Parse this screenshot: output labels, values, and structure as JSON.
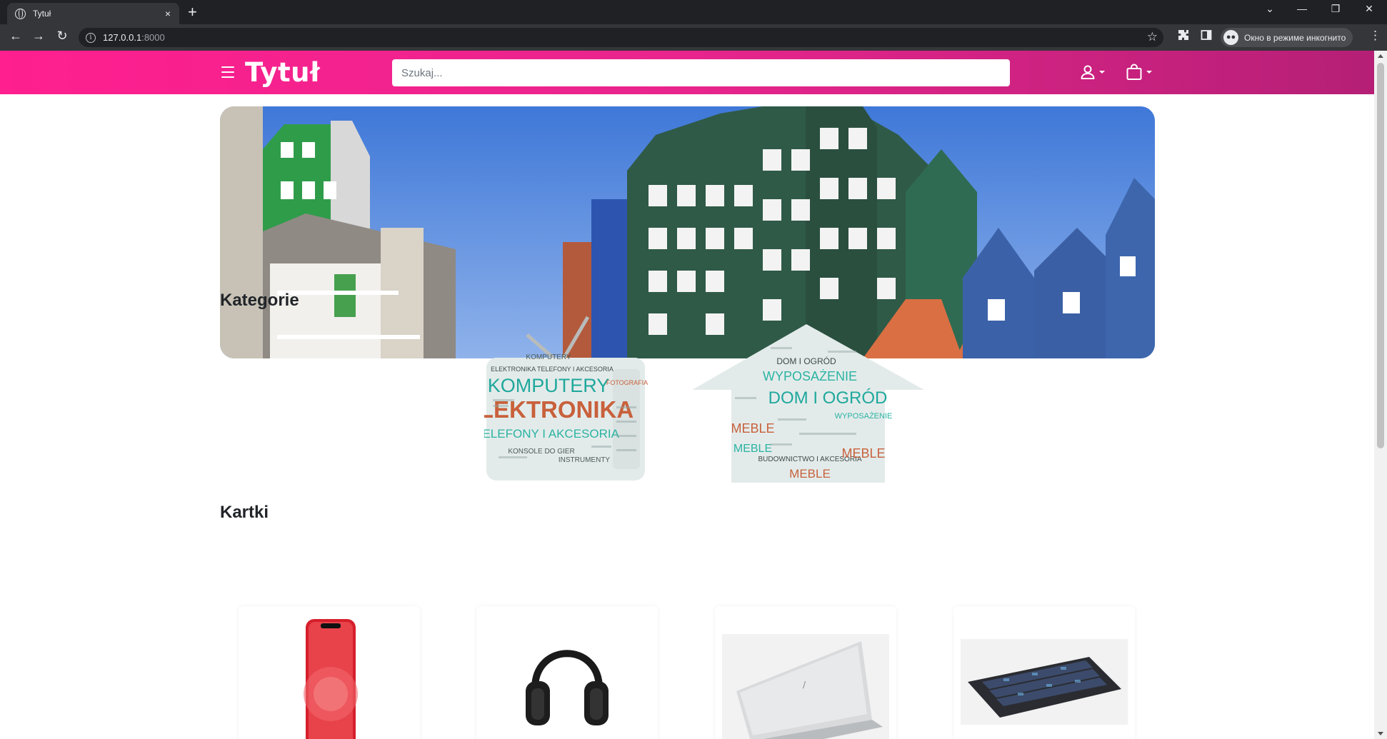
{
  "browser": {
    "tab_title": "Tytuł",
    "tab_close": "×",
    "new_tab": "+",
    "window_controls": {
      "tab_search": "⌄",
      "minimize": "—",
      "restore": "❐",
      "close": "✕"
    },
    "nav": {
      "back": "←",
      "forward": "→",
      "reload": "↻"
    },
    "url_host": "127.0.0.1",
    "url_port": ":8000",
    "bookmark_star": "☆",
    "incognito_label": "Окно в режиме инкогнито",
    "menu": "⋮"
  },
  "site": {
    "brand": "Tytuł",
    "search_placeholder": "Szukaj...",
    "accent_gradient": [
      "#ff1f8f",
      "#e8258d",
      "#b51f76"
    ],
    "icons": {
      "menu": "hamburger-menu-icon",
      "account": "user-icon",
      "cart": "shopping-bag-icon"
    }
  },
  "sections": {
    "categories_title": "Kategorie",
    "cards_title": "Kartki"
  },
  "categories": [
    {
      "id": "electronics",
      "shape": "tv-word-cloud",
      "words": [
        "KOMPUTERY",
        "ELEKTRONIKA",
        "TELEFONY I AKCESORIA",
        "FOTOGRAFIA",
        "ELEKTRONIKA TELEFONY I AKCESORIA",
        "KONSOLE DO GIER",
        "INSTRUMENTY",
        "KOMPUTERY"
      ]
    },
    {
      "id": "home-garden",
      "shape": "house-word-cloud",
      "words": [
        "DOM I OGRÓD",
        "WYPOSAŻENIE",
        "DOM I OGRÓD",
        "MEBLE",
        "MEBLE",
        "BUDOWNICTWO I AKCESORIA",
        "MEBLE",
        "WYPOSAŻENIE",
        "MEBLE"
      ]
    }
  ],
  "cards": [
    {
      "product": "red-smartphone"
    },
    {
      "product": "black-headphones"
    },
    {
      "product": "silver-laptop"
    },
    {
      "product": "rgb-keyboard"
    }
  ]
}
